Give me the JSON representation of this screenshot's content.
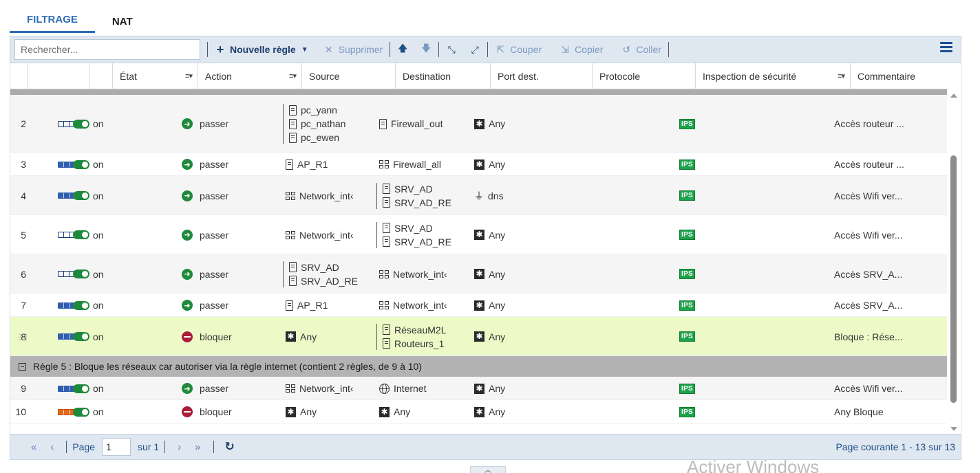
{
  "tabs": [
    {
      "label": "FILTRAGE",
      "active": true
    },
    {
      "label": "NAT",
      "active": false
    }
  ],
  "toolbar": {
    "search_placeholder": "Rechercher...",
    "new_rule": "Nouvelle règle",
    "delete": "Supprimer",
    "cut": "Couper",
    "copy": "Copier",
    "paste": "Coller"
  },
  "columns": {
    "state": "État",
    "action": "Action",
    "source": "Source",
    "destination": "Destination",
    "port": "Port dest.",
    "protocol": "Protocole",
    "inspection": "Inspection de sécurité",
    "comment": "Commentaire"
  },
  "rows": [
    {
      "num": "2",
      "status_ind": "outline",
      "state": "on",
      "action": "passer",
      "action_type": "pass",
      "source": [
        "pc_yann",
        "pc_nathan",
        "pc_ewen"
      ],
      "source_icon": "host",
      "destination": [
        "Firewall_out"
      ],
      "destination_icon": "host",
      "port": "Any",
      "port_icon": "any",
      "inspection": "IPS",
      "comment": "Accès routeur ..."
    },
    {
      "num": "3",
      "status_ind": "filled",
      "state": "on",
      "action": "passer",
      "action_type": "pass",
      "source": [
        "AP_R1"
      ],
      "source_icon": "host",
      "destination": [
        "Firewall_all"
      ],
      "destination_icon": "network",
      "port": "Any",
      "port_icon": "any",
      "inspection": "IPS",
      "comment": "Accès routeur ..."
    },
    {
      "num": "4",
      "status_ind": "filled",
      "state": "on",
      "action": "passer",
      "action_type": "pass",
      "source": [
        "Network_int‹"
      ],
      "source_icon": "network",
      "destination": [
        "SRV_AD",
        "SRV_AD_RE"
      ],
      "destination_icon": "host",
      "port": "dns",
      "port_icon": "plug",
      "inspection": "IPS",
      "comment": "Accès Wifi ver..."
    },
    {
      "num": "5",
      "status_ind": "outline",
      "state": "on",
      "action": "passer",
      "action_type": "pass",
      "source": [
        "Network_int‹"
      ],
      "source_icon": "network",
      "destination": [
        "SRV_AD",
        "SRV_AD_RE"
      ],
      "destination_icon": "host",
      "port": "Any",
      "port_icon": "any",
      "inspection": "IPS",
      "comment": "Accès Wifi ver..."
    },
    {
      "num": "6",
      "status_ind": "outline",
      "state": "on",
      "action": "passer",
      "action_type": "pass",
      "source": [
        "SRV_AD",
        "SRV_AD_RE"
      ],
      "source_icon": "host",
      "destination": [
        "Network_int‹"
      ],
      "destination_icon": "network",
      "port": "Any",
      "port_icon": "any",
      "inspection": "IPS",
      "comment": "Accès SRV_A..."
    },
    {
      "num": "7",
      "status_ind": "filled",
      "state": "on",
      "action": "passer",
      "action_type": "pass",
      "source": [
        "AP_R1"
      ],
      "source_icon": "host",
      "destination": [
        "Network_int‹"
      ],
      "destination_icon": "network",
      "port": "Any",
      "port_icon": "any",
      "inspection": "IPS",
      "comment": "Accès SRV_A..."
    },
    {
      "num": "8",
      "status_ind": "filled",
      "state": "on",
      "action": "bloquer",
      "action_type": "block",
      "source": [
        "Any"
      ],
      "source_icon": "any",
      "destination": [
        "RéseauM2L",
        "Routeurs_1"
      ],
      "destination_icon": "host",
      "port": "Any",
      "port_icon": "any",
      "inspection": "IPS",
      "comment": "Bloque : Rése..."
    }
  ],
  "group": {
    "label": "Règle 5 : Bloque les réseaux car autoriser via la règle internet (contient 2 règles, de 9 à 10)"
  },
  "rows2": [
    {
      "num": "9",
      "status_ind": "filled",
      "state": "on",
      "action": "passer",
      "action_type": "pass",
      "source": [
        "Network_int‹"
      ],
      "source_icon": "network",
      "destination": [
        "Internet"
      ],
      "destination_icon": "globe",
      "port": "Any",
      "port_icon": "any",
      "inspection": "IPS",
      "comment": "Accès Wifi ver..."
    },
    {
      "num": "10",
      "status_ind": "orange",
      "state": "on",
      "action": "bloquer",
      "action_type": "block",
      "source": [
        "Any"
      ],
      "source_icon": "any",
      "destination": [
        "Any"
      ],
      "destination_icon": "any",
      "port": "Any",
      "port_icon": "any",
      "inspection": "IPS",
      "comment": "Any Bloque"
    }
  ],
  "footer": {
    "page_label": "Page",
    "page_value": "1",
    "of_label": "sur 1",
    "page_info": "Page courante 1 - 13 sur 13"
  },
  "watermark": "Activer Windows"
}
